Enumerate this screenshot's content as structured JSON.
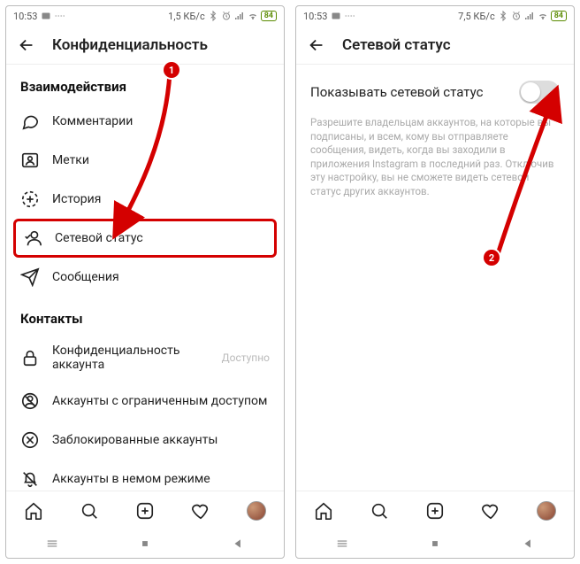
{
  "statusbar": {
    "time": "10:53",
    "speed1": "1,5 КБ/с",
    "speed2": "7,5 КБ/с",
    "battery": "84"
  },
  "screen1": {
    "title": "Конфиденциальность",
    "section1": "Взаимодействия",
    "items1": [
      {
        "label": "Комментарии"
      },
      {
        "label": "Метки"
      },
      {
        "label": "История"
      },
      {
        "label": "Сетевой статус"
      },
      {
        "label": "Сообщения"
      }
    ],
    "section2": "Контакты",
    "items2": [
      {
        "label": "Конфиденциальность аккаунта",
        "trail": "Доступно"
      },
      {
        "label": "Аккаунты с ограниченным доступом"
      },
      {
        "label": "Заблокированные аккаунты"
      },
      {
        "label": "Аккаунты в немом режиме"
      }
    ]
  },
  "screen2": {
    "title": "Сетевой статус",
    "toggle_label": "Показывать сетевой статус",
    "description": "Разрешите владельцам аккаунтов, на которые вы подписаны, и всем, кому вы отправляете сообщения, видеть, когда вы заходили в приложения Instagram в последний раз. Отключив эту настройку, вы не сможете видеть сетевой статус других аккаунтов."
  },
  "annotations": {
    "b1": "1",
    "b2": "2"
  }
}
